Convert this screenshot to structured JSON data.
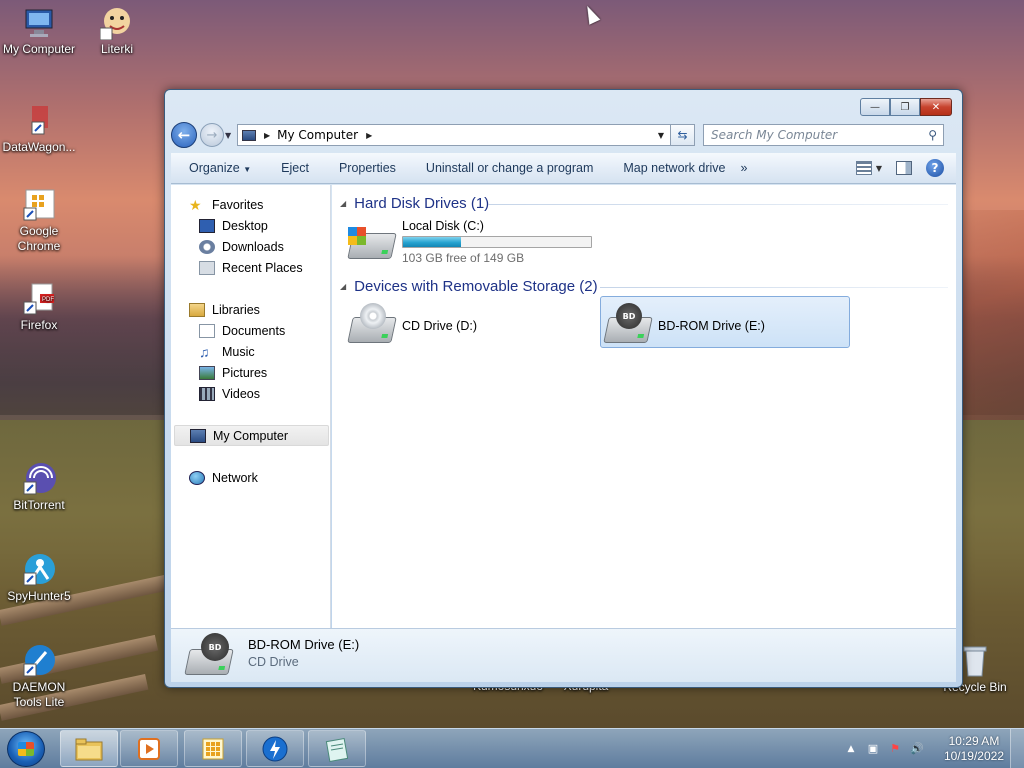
{
  "desktop": {
    "icons": [
      {
        "label": "My Computer",
        "icon": "computer-icon"
      },
      {
        "label": "Literki",
        "icon": "literki-app-icon"
      },
      {
        "label": "DataWagon...",
        "icon": "datawagon-icon"
      },
      {
        "label": "Google Chrome",
        "icon": "chrome-shortcut-icon"
      },
      {
        "label": "Firefox",
        "icon": "firefox-shortcut-icon"
      },
      {
        "label": "BitTorrent",
        "icon": "bittorrent-icon"
      },
      {
        "label": "SpyHunter5",
        "icon": "spyhunter-icon"
      },
      {
        "label": "DAEMON Tools Lite",
        "icon": "daemon-tools-icon"
      },
      {
        "label": "Recycle Bin",
        "icon": "recycle-bin-icon"
      }
    ],
    "partial_labels": [
      "Kumosunxuo",
      "Xurupita"
    ]
  },
  "window": {
    "address": {
      "location": "My Computer"
    },
    "search": {
      "placeholder": "Search My Computer"
    },
    "toolbar": {
      "organize": "Organize",
      "eject": "Eject",
      "properties": "Properties",
      "uninstall": "Uninstall or change a program",
      "map_drive": "Map network drive",
      "more": "»"
    },
    "nav": {
      "favorites": "Favorites",
      "desktop": "Desktop",
      "downloads": "Downloads",
      "recent_places": "Recent Places",
      "libraries": "Libraries",
      "documents": "Documents",
      "music": "Music",
      "pictures": "Pictures",
      "videos": "Videos",
      "my_computer": "My Computer",
      "network": "Network"
    },
    "groups": {
      "hdd_header": "Hard Disk Drives (1)",
      "removable_header": "Devices with Removable Storage (2)"
    },
    "drives": {
      "local_disk": {
        "name": "Local Disk (C:)",
        "free_text": "103 GB free of 149 GB",
        "used_fraction": 0.31
      },
      "cd_drive": {
        "name": "CD Drive (D:)"
      },
      "bd_drive": {
        "name": "BD-ROM Drive (E:)",
        "badge": "BD"
      }
    },
    "details": {
      "name": "BD-ROM Drive (E:)",
      "type": "CD Drive",
      "badge": "BD"
    }
  },
  "taskbar": {
    "time": "10:29 AM",
    "date": "10/19/2022"
  }
}
